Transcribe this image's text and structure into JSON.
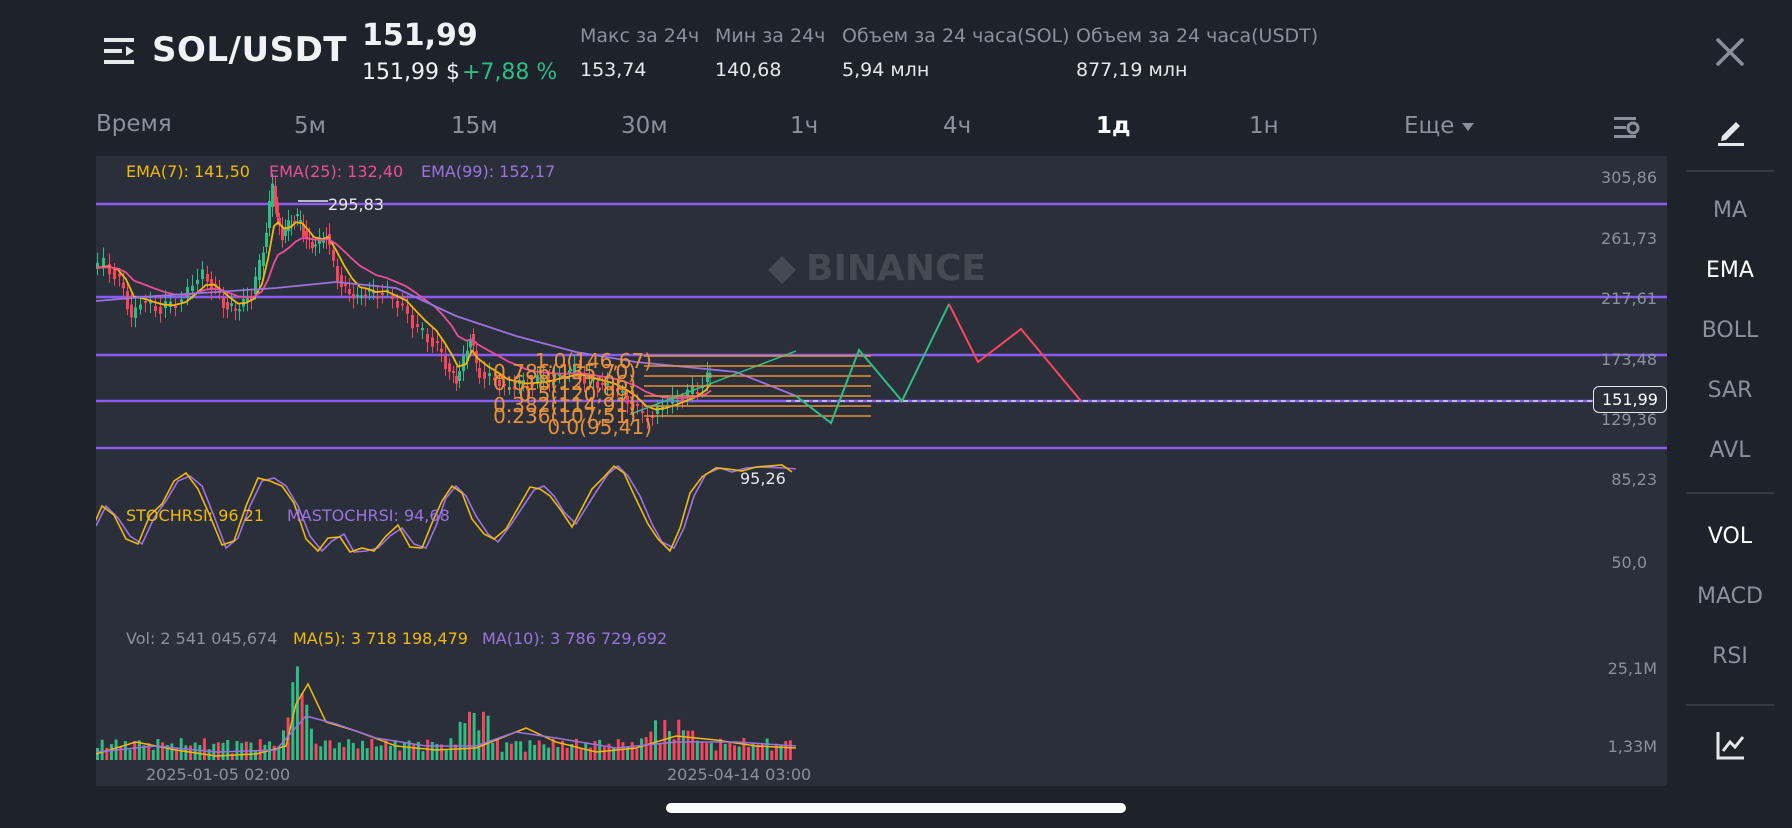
{
  "header": {
    "pair": "SOL/USDT",
    "price": "151,99",
    "price_usd": "151,99 $",
    "change": "+7,88 %",
    "stats": [
      {
        "label": "Макс за 24ч",
        "value": "153,74"
      },
      {
        "label": "Мин за 24ч",
        "value": "140,68"
      },
      {
        "label": "Объем за 24 часа(SOL)",
        "value": "5,94 млн"
      },
      {
        "label": "Объем за 24 часа(USDT)",
        "value": "877,19 млн"
      }
    ]
  },
  "timebar": {
    "label": "Время",
    "tabs": [
      "5м",
      "15м",
      "30м",
      "1ч",
      "4ч",
      "1д",
      "1н"
    ],
    "active": "1д",
    "more": "Еще"
  },
  "chart": {
    "watermark": "BINANCE",
    "ema": {
      "ema7": "EMA(7): 141,50",
      "ema25": "EMA(25): 132,40",
      "ema99": "EMA(99): 152,17"
    },
    "price_axis": [
      "305,86",
      "261,73",
      "217,61",
      "173,48",
      "129,36",
      "85,23"
    ],
    "current_price": "151,99",
    "high_label": "295,83",
    "low_label": "95,26",
    "fib_labels": [
      "1.0(146,67)",
      "0.786(135,70)",
      "0.618(127,06)",
      "0.5(120,99)",
      "0.382(114,91)",
      "0.236(107,51)",
      "0.0(95,41)"
    ],
    "stoch": {
      "k": "STOCHRSI: 96,21",
      "d": "MASTOCHRSI: 94,68",
      "axis": "50,0"
    },
    "volume": {
      "vol": "Vol: 2 541 045,674",
      "ma5": "MA(5): 3 718 198,479",
      "ma10": "MA(10): 3 786 729,692",
      "axis_top": "25,1M",
      "axis_bottom": "1,33M"
    },
    "dates": [
      "2025-01-05 02:00",
      "2025-04-14 03:00"
    ],
    "colors": {
      "up": "#2ebd85",
      "down": "#f6465d",
      "ema7": "#f0b90b",
      "ema25": "#e84f9a",
      "ema99": "#9b73e0",
      "level": "#8a5cf5",
      "fib": "#e8913b"
    }
  },
  "panel": {
    "indicators_main": [
      "MA",
      "EMA",
      "BOLL",
      "SAR",
      "AVL"
    ],
    "active_main": "EMA",
    "indicators_sub": [
      "VOL",
      "MACD",
      "RSI"
    ],
    "active_sub": "VOL"
  },
  "chart_data": {
    "type": "candlestick",
    "title": "SOL/USDT",
    "interval": "1д",
    "ylim": [
      85.23,
      305.86
    ],
    "y_ticks": [
      305.86,
      261.73,
      217.61,
      173.48,
      129.36,
      85.23
    ],
    "x_ticks": [
      "2025-01-05 02:00",
      "2025-04-14 03:00"
    ],
    "last_price": 151.99,
    "high": 295.83,
    "low": 95.26,
    "series": [
      {
        "name": "EMA(7)",
        "last": 141.5
      },
      {
        "name": "EMA(25)",
        "last": 132.4
      },
      {
        "name": "EMA(99)",
        "last": 152.17
      }
    ],
    "horizontal_levels": [
      296,
      222,
      178,
      150,
      116
    ],
    "fibonacci": [
      {
        "level": 1.0,
        "price": 146.67
      },
      {
        "level": 0.786,
        "price": 135.7
      },
      {
        "level": 0.618,
        "price": 127.06
      },
      {
        "level": 0.5,
        "price": 120.99
      },
      {
        "level": 0.382,
        "price": 114.91
      },
      {
        "level": 0.236,
        "price": 107.51
      },
      {
        "level": 0.0,
        "price": 95.41
      }
    ],
    "stochrsi": {
      "k": 96.21,
      "d": 94.68
    },
    "volume": {
      "last": 2541045.674,
      "ma5": 3718198.479,
      "ma10": 3786729.692
    }
  }
}
